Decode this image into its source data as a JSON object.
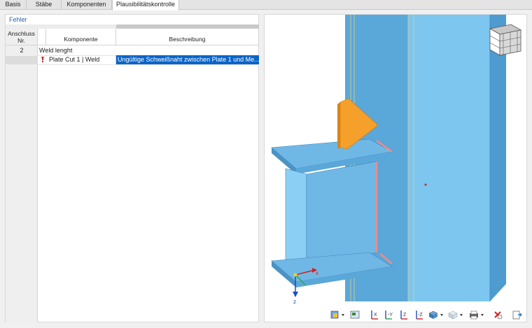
{
  "tabs": [
    {
      "label": "Basis",
      "active": false
    },
    {
      "label": "Stäbe",
      "active": false
    },
    {
      "label": "Komponenten",
      "active": false
    },
    {
      "label": "Plausibilitätskontrolle",
      "active": true
    }
  ],
  "panel": {
    "title": "Fehler",
    "columns": {
      "anschluss_line1": "Anschluss",
      "anschluss_line2": "Nr.",
      "komponente": "Komponente",
      "beschreibung": "Beschreibung"
    },
    "group": {
      "nr": "2",
      "label": "Weld lenght"
    },
    "row": {
      "komponente": "Plate Cut 1 | Weld",
      "beschreibung": "Ungültige Schweißnaht zwischen Plate 1 und Me..."
    }
  },
  "viewport": {
    "axis_x": "x",
    "axis_z": "z"
  },
  "colors": {
    "steel": "#6fb8e6",
    "steel_dark": "#4a93c4",
    "plate": "#f5a02a",
    "weld": "#f08a8a",
    "selection": "#0a64c8",
    "error_icon": "#d42020"
  },
  "toolbar_icons": [
    "section-icon",
    "display-icon",
    "view-x-icon",
    "view-y-icon",
    "view-z-icon",
    "view-iso-icon",
    "render-icon",
    "transparency-icon",
    "print-icon",
    "reset-icon",
    "export-icon"
  ]
}
